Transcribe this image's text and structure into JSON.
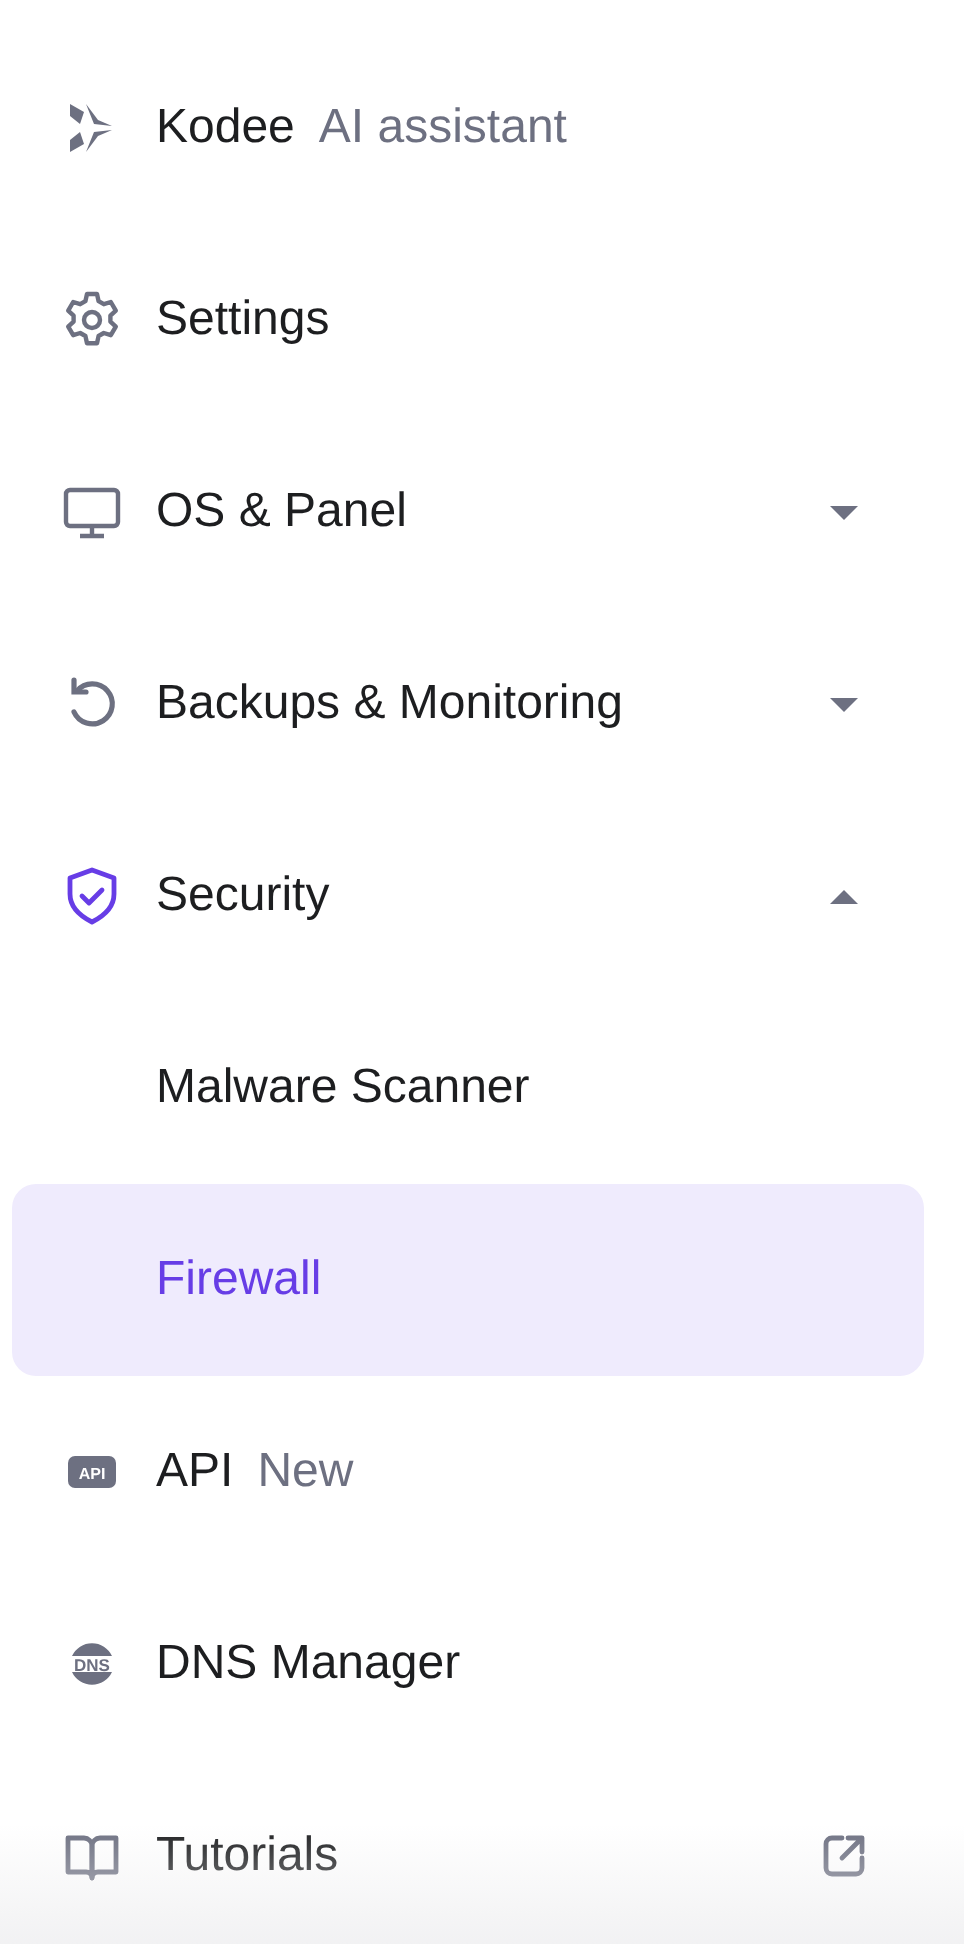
{
  "menu": [
    {
      "label": "Kodee",
      "note": "AI assistant",
      "selected": false
    },
    {
      "label": "Settings",
      "selected": false
    },
    {
      "label": "OS & Panel",
      "selected": false,
      "expanded": false
    },
    {
      "label": "Backups & Monitoring",
      "selected": false,
      "expanded": false
    },
    {
      "label": "Security",
      "selected": false,
      "expanded": true,
      "children": [
        {
          "label": "Malware Scanner",
          "selected": false
        },
        {
          "label": "Firewall",
          "selected": true
        }
      ]
    },
    {
      "label": "API",
      "note": "New",
      "icon_text": "API",
      "selected": false
    },
    {
      "label": "DNS Manager",
      "icon_text": "DNS",
      "selected": false
    },
    {
      "label": "Tutorials",
      "selected": false,
      "external": true
    }
  ]
}
